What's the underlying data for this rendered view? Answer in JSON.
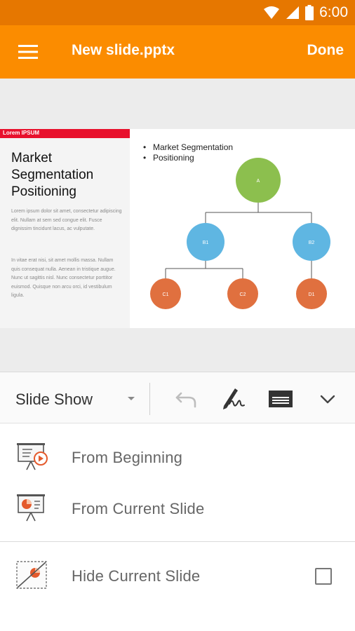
{
  "status_bar": {
    "time": "6:00",
    "icons": [
      "wifi-icon",
      "signal-icon",
      "battery-icon"
    ]
  },
  "app_bar": {
    "title": "New slide.pptx",
    "done_label": "Done",
    "menu_icon": "hamburger-menu-icon"
  },
  "slide": {
    "tag": "Lorem IPSUM",
    "title": "Market Segmentation Positioning",
    "paragraph1": "Lorem ipsum dolor sit amet, consectetur adipiscing elit. Nullam at sem sed congue elit. Fusce dignissim tincidunt lacus, ac vulputate.",
    "paragraph2": "In vitae erat nisi, sit amet mollis massa. Nullam quis consequat nulla. Aenean in tristique augue. Nunc ut sagittis nisl. Nunc consectetur porttitor euismod. Quisque non arcu orci, id vestibulum ligula.",
    "bullets": [
      "Market Segmentation",
      "Positioning"
    ],
    "nodes": [
      {
        "id": "A",
        "label": "A",
        "color": "#8cbf4e"
      },
      {
        "id": "B1",
        "label": "B1",
        "color": "#5fb6e2"
      },
      {
        "id": "B2",
        "label": "B2",
        "color": "#5fb6e2"
      },
      {
        "id": "C1",
        "label": "C1",
        "color": "#e0703f"
      },
      {
        "id": "C2",
        "label": "C2",
        "color": "#e0703f"
      },
      {
        "id": "D1",
        "label": "D1",
        "color": "#e0703f"
      }
    ]
  },
  "toolbar": {
    "mode_label": "Slide Show",
    "icons": [
      "undo-icon",
      "pen-signature-icon",
      "keyboard-box-icon",
      "chevron-down-icon"
    ]
  },
  "menu": {
    "from_beginning": "From Beginning",
    "from_current": "From Current Slide",
    "hide_current": "Hide Current Slide",
    "hide_checked": false
  },
  "colors": {
    "status_bar": "#e67700",
    "app_bar": "#fb8c00",
    "accent_red": "#e8112d"
  }
}
